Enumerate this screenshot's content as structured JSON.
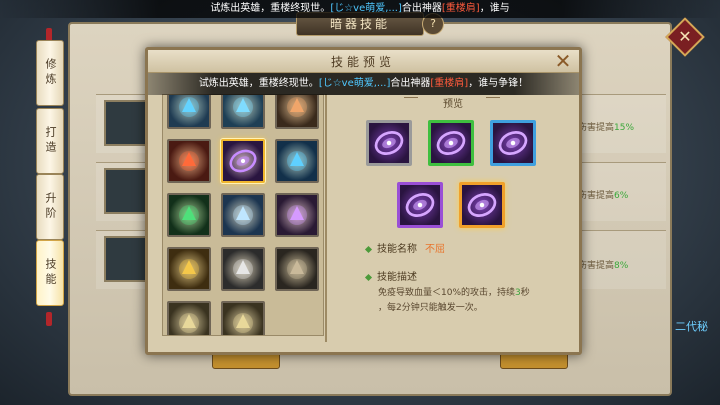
{
  "marquee": {
    "part1": "试炼出英雄，重楼终现世。",
    "player": "[じ☆ve萌爱,...]",
    "part2": "合出神器",
    "item": "[重楼肩]",
    "part3": "，谁与"
  },
  "background": {
    "title": "暗器技能",
    "help": "?",
    "side_tabs": [
      {
        "label": "修炼"
      },
      {
        "label": "打造"
      },
      {
        "label": "升阶"
      },
      {
        "label": "技能"
      }
    ],
    "effects": [
      {
        "text": "伤害提高",
        "value": "15%"
      },
      {
        "text": "伤害提高",
        "value": "6%"
      },
      {
        "text": "伤害提高",
        "value": "8%"
      }
    ],
    "link": "二代秘",
    "close_icon": "x-icon"
  },
  "modal": {
    "title": "技能预览",
    "close": "✕",
    "banner": {
      "part1": "试炼出英雄，重楼终现世。",
      "player": "[じ☆ve萌爱,...]",
      "part2": "合出神器",
      "item": "[重楼肩]",
      "part3": "，谁与争锋！"
    },
    "preview_title": "预览",
    "skill_name_label": "技能名称",
    "skill_name": "不屈",
    "skill_desc_label": "技能描述",
    "desc_a": "免疫导致血量＜10%的攻击，持续",
    "desc_num": "3",
    "desc_b": "秒",
    "desc_line2": "，每2分钟只能触发一次。"
  },
  "grid_icons": [
    {
      "name": "sapphire-burst-icon",
      "bg": "#1f3b52",
      "fg": "#63d3ff"
    },
    {
      "name": "sapphire-burst-icon",
      "bg": "#1e3f55",
      "fg": "#7fdcff"
    },
    {
      "name": "praying-hands-icon",
      "bg": "#3a2a1c",
      "fg": "#f0a56a"
    },
    {
      "name": "fire-hand-icon",
      "bg": "#4a1a12",
      "fg": "#ff6a3a"
    },
    {
      "name": "purple-disc-icon",
      "bg": "#2a1540",
      "fg": "#c78cff",
      "selected": true
    },
    {
      "name": "ice-hand-icon",
      "bg": "#12304a",
      "fg": "#5fd0ff"
    },
    {
      "name": "nature-hand-icon",
      "bg": "#12301a",
      "fg": "#4ee07a"
    },
    {
      "name": "ice-shield-icon",
      "bg": "#1c3550",
      "fg": "#bfe6ff"
    },
    {
      "name": "dark-shield-icon",
      "bg": "#2a1a34",
      "fg": "#d59aff"
    },
    {
      "name": "gold-sword-icon",
      "bg": "#3e2d10",
      "fg": "#f5c84a"
    },
    {
      "name": "silver-dart-icon",
      "bg": "#2c2c2c",
      "fg": "#e6e6e6"
    },
    {
      "name": "hammer-icon",
      "bg": "#2a2620",
      "fg": "#c9b99a"
    },
    {
      "name": "crossbow-icon",
      "bg": "#3a3320",
      "fg": "#e8d89a"
    },
    {
      "name": "crossbow-icon",
      "bg": "#3a3320",
      "fg": "#e8d89a"
    }
  ],
  "preview_slots": [
    {
      "name": "preview-disc-gray-icon",
      "border": "#9a9a9a"
    },
    {
      "name": "preview-disc-green-icon",
      "border": "#3fbf3f"
    },
    {
      "name": "preview-disc-blue-icon",
      "border": "#3f9fdf"
    },
    {
      "name": "preview-disc-purple-icon",
      "border": "#9a4fd6"
    },
    {
      "name": "preview-disc-orange-icon",
      "border": "#f0a02a",
      "selected": true
    }
  ]
}
